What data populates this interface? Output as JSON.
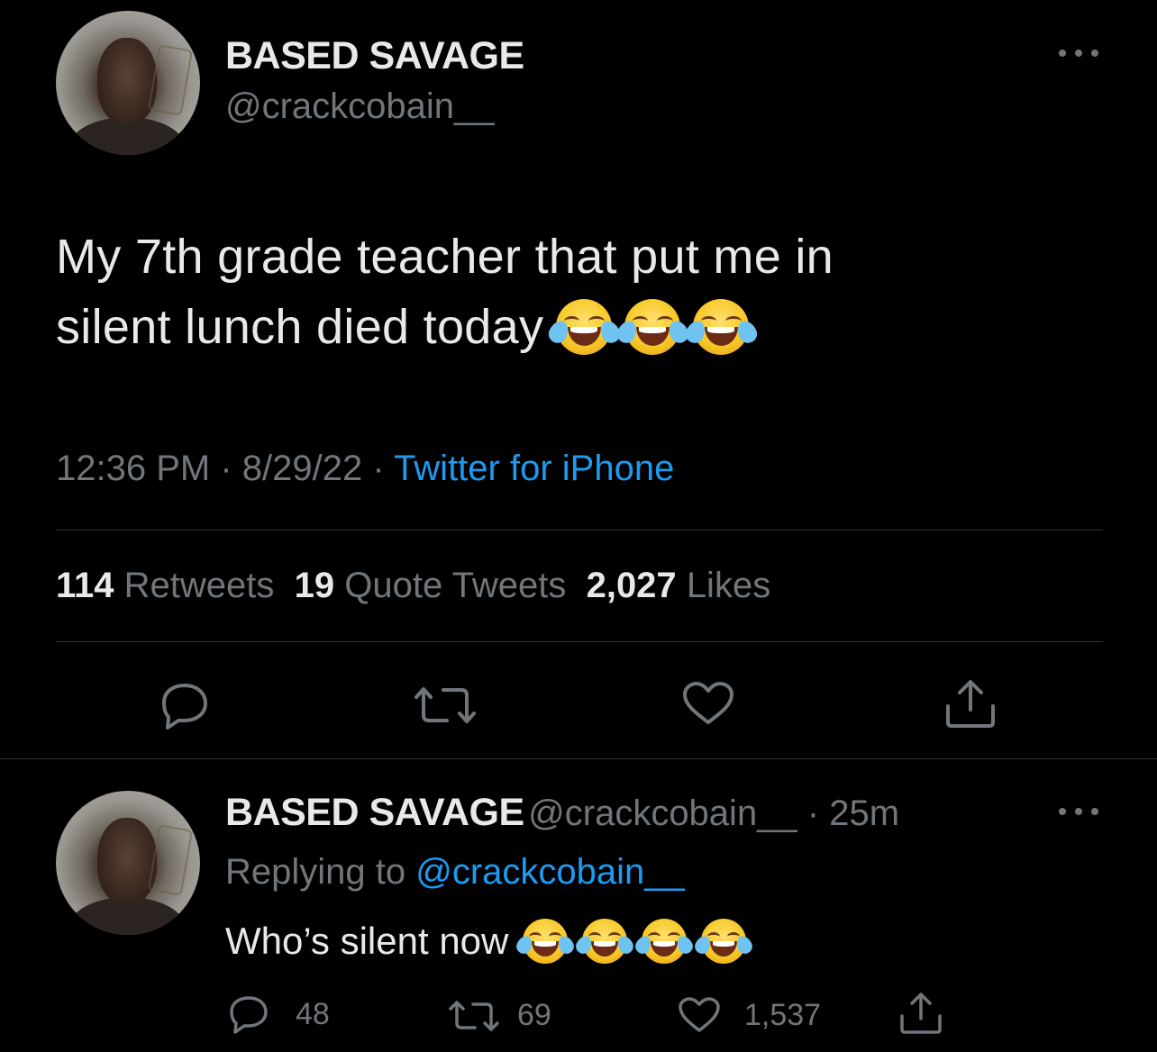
{
  "tweet": {
    "display_name": "BASED SAVAGE",
    "handle": "@crackcobain__",
    "text": "My 7th grade teacher that put me in silent lunch died today",
    "text_line1": "My 7th grade teacher that put me in",
    "text_line2": "silent lunch died today",
    "emoji": [
      "😂",
      "😂",
      "😂"
    ],
    "time": "12:36 PM",
    "sep1": " · ",
    "date": "8/29/22",
    "sep2": " · ",
    "source": "Twitter for iPhone",
    "stats": {
      "retweets_count": "114",
      "retweets_label": "Retweets",
      "quotes_count": "19",
      "quotes_label": "Quote Tweets",
      "likes_count": "2,027",
      "likes_label": "Likes"
    },
    "icons": [
      "more-icon",
      "reply-icon",
      "retweet-icon",
      "like-icon",
      "share-icon"
    ]
  },
  "reply": {
    "display_name": "BASED SAVAGE",
    "handle": "@crackcobain__",
    "sep": " · ",
    "age": "25m",
    "replying_prefix": "Replying to ",
    "replying_handle": "@crackcobain__",
    "text": "Who’s silent now",
    "emoji": [
      "😂",
      "😂",
      "😂",
      "😂"
    ],
    "reply_count": "48",
    "retweet_count": "69",
    "like_count": "1,537"
  },
  "colors": {
    "background": "#000000",
    "primary_text": "#e7e9ea",
    "secondary_text": "#71767b",
    "link": "#1d9bf0",
    "divider": "#2f3336"
  }
}
